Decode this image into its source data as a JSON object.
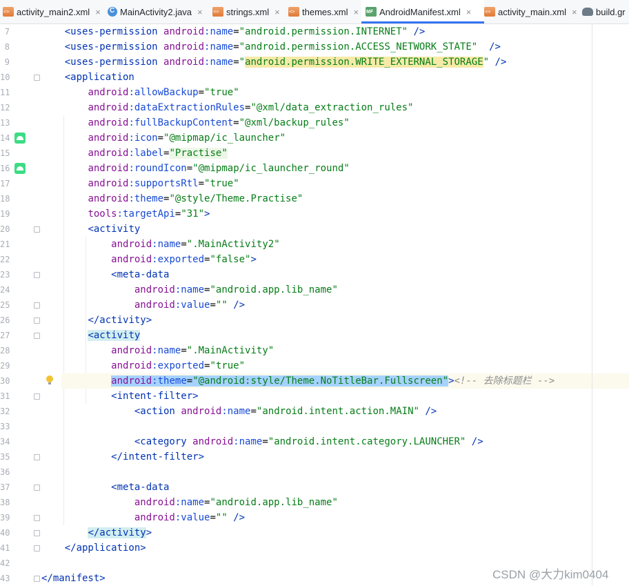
{
  "tabs": [
    {
      "label": "activity_main2.xml",
      "icon": "xml-file-icon",
      "active": false
    },
    {
      "label": "MainActivity2.java",
      "icon": "java-class-icon",
      "active": false
    },
    {
      "label": "strings.xml",
      "icon": "xml-file-icon",
      "active": false
    },
    {
      "label": "themes.xml",
      "icon": "xml-file-icon",
      "active": false
    },
    {
      "label": "AndroidManifest.xml",
      "icon": "manifest-file-icon",
      "active": true
    },
    {
      "label": "activity_main.xml",
      "icon": "xml-file-icon",
      "active": false
    },
    {
      "label": "build.gr",
      "icon": "gradle-file-icon",
      "active": false
    }
  ],
  "tab_close_glyph": "×",
  "accent_color": "#3574f0",
  "editor": {
    "lines": [
      {
        "n": "7",
        "code": "    <uses-permission android:name=\"android.permission.INTERNET\" />"
      },
      {
        "n": "8",
        "code": "    <uses-permission android:name=\"android.permission.ACCESS_NETWORK_STATE\"  />"
      },
      {
        "n": "9",
        "code": "    <uses-permission android:name=\"android.permission.WRITE_EXTERNAL_STORAGE\" />"
      },
      {
        "n": "10",
        "code": "    <application"
      },
      {
        "n": "11",
        "code": "        android:allowBackup=\"true\""
      },
      {
        "n": "12",
        "code": "        android:dataExtractionRules=\"@xml/data_extraction_rules\""
      },
      {
        "n": "13",
        "code": "        android:fullBackupContent=\"@xml/backup_rules\""
      },
      {
        "n": "14",
        "code": "        android:icon=\"@mipmap/ic_launcher\""
      },
      {
        "n": "15",
        "code": "        android:label=\"Practise\""
      },
      {
        "n": "16",
        "code": "        android:roundIcon=\"@mipmap/ic_launcher_round\""
      },
      {
        "n": "17",
        "code": "        android:supportsRtl=\"true\""
      },
      {
        "n": "18",
        "code": "        android:theme=\"@style/Theme.Practise\""
      },
      {
        "n": "19",
        "code": "        tools:targetApi=\"31\">"
      },
      {
        "n": "20",
        "code": "        <activity"
      },
      {
        "n": "21",
        "code": "            android:name=\".MainActivity2\""
      },
      {
        "n": "22",
        "code": "            android:exported=\"false\">"
      },
      {
        "n": "23",
        "code": "            <meta-data"
      },
      {
        "n": "24",
        "code": "                android:name=\"android.app.lib_name\""
      },
      {
        "n": "25",
        "code": "                android:value=\"\" />"
      },
      {
        "n": "26",
        "code": "        </activity>"
      },
      {
        "n": "27",
        "code": "        <activity"
      },
      {
        "n": "28",
        "code": "            android:name=\".MainActivity\""
      },
      {
        "n": "29",
        "code": "            android:exported=\"true\""
      },
      {
        "n": "30",
        "code": "            android:theme=\"@android:style/Theme.NoTitleBar.Fullscreen\"> <!-- 去除标题栏 -->"
      },
      {
        "n": "31",
        "code": "            <intent-filter>"
      },
      {
        "n": "32",
        "code": "                <action android:name=\"android.intent.action.MAIN\" />"
      },
      {
        "n": "33",
        "code": ""
      },
      {
        "n": "34",
        "code": "                <category android:name=\"android.intent.category.LAUNCHER\" />"
      },
      {
        "n": "35",
        "code": "            </intent-filter>"
      },
      {
        "n": "36",
        "code": ""
      },
      {
        "n": "37",
        "code": "            <meta-data"
      },
      {
        "n": "38",
        "code": "                android:name=\"android.app.lib_name\""
      },
      {
        "n": "39",
        "code": "                android:value=\"\" />"
      },
      {
        "n": "40",
        "code": "        </activity>"
      },
      {
        "n": "41",
        "code": "    </application>"
      },
      {
        "n": "42",
        "code": ""
      },
      {
        "n": "43",
        "code": "</manifest>"
      }
    ]
  },
  "gutter_icons": [
    {
      "line": "14",
      "icon": "android-launcher-icon"
    },
    {
      "line": "16",
      "icon": "android-round-launcher-icon"
    }
  ],
  "intention_bulb_line": "30",
  "watermark": "CSDN @大力kim0404"
}
